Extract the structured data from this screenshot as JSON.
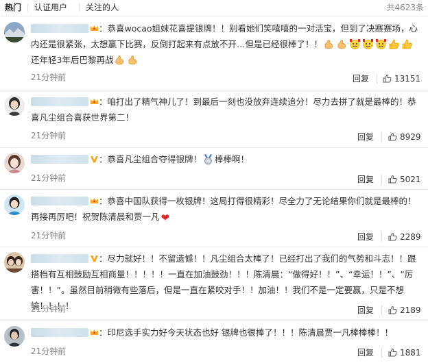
{
  "tabs": {
    "hot": "热门",
    "verified": "认证用户",
    "following": "关注的人"
  },
  "total": "共4623条",
  "comments": [
    {
      "text1": "：恭喜wocao姐妹花喜提银牌！！别看她们笑嘻嘻的一对活宝，但到了决赛赛场，心内还是很紧张，太想赢下比赛，反倒打起来有点放不开…但是已经很棒了！！",
      "text2": "还年轻3年后巴黎再战",
      "time": "21分钟前",
      "reply": "回复",
      "likes": "13151"
    },
    {
      "text1": "：咱打出了精气神儿了！到最后一刻也没放弃连续追分！尽力去拼了就是最棒的！恭喜凡尘组合喜获世界第二！",
      "time": "21分钟前",
      "reply": "回复",
      "likes": "8929"
    },
    {
      "text1": "：恭喜凡尘组合夺得银牌！",
      "text2": "棒棒啊！",
      "time": "21分钟前",
      "reply": "回复",
      "likes": "5021"
    },
    {
      "text1": "：恭喜中国队获得一枚银牌！这局打得很精彩！尽全力了无论结果你们就是最棒的！再接再厉吧！祝贺陈清晨和贾一凡",
      "time": "21分钟前",
      "reply": "回复",
      "likes": "2289"
    },
    {
      "text1": "：尽力就好！！不留遗憾！！凡尘组合太棒了！已经打出了我们的气势和斗志！！跟搭档有互相鼓励互相商量！！！！！一直在加油鼓劲！！！陈清晨：“做得好！！”、“幸运！！”、“厉害！！”。虽然目前稍微有些落后，但是一直在紧咬对手！！加油！！我们不是一定要赢，只是不想输！！！！",
      "time": "21分钟前",
      "reply": "回复",
      "likes": "2189"
    },
    {
      "text1": "：印尼选手实力好今天状态也好 银牌也很棒了！！！陈清晨贾一凡棒棒棒！！",
      "time": "21分钟前",
      "reply": "回复",
      "likes": "1881"
    }
  ],
  "colors": {
    "accent": "#ff8200",
    "gold": "#f5a623",
    "heart": "#e02a2a",
    "muted": "#888888"
  }
}
